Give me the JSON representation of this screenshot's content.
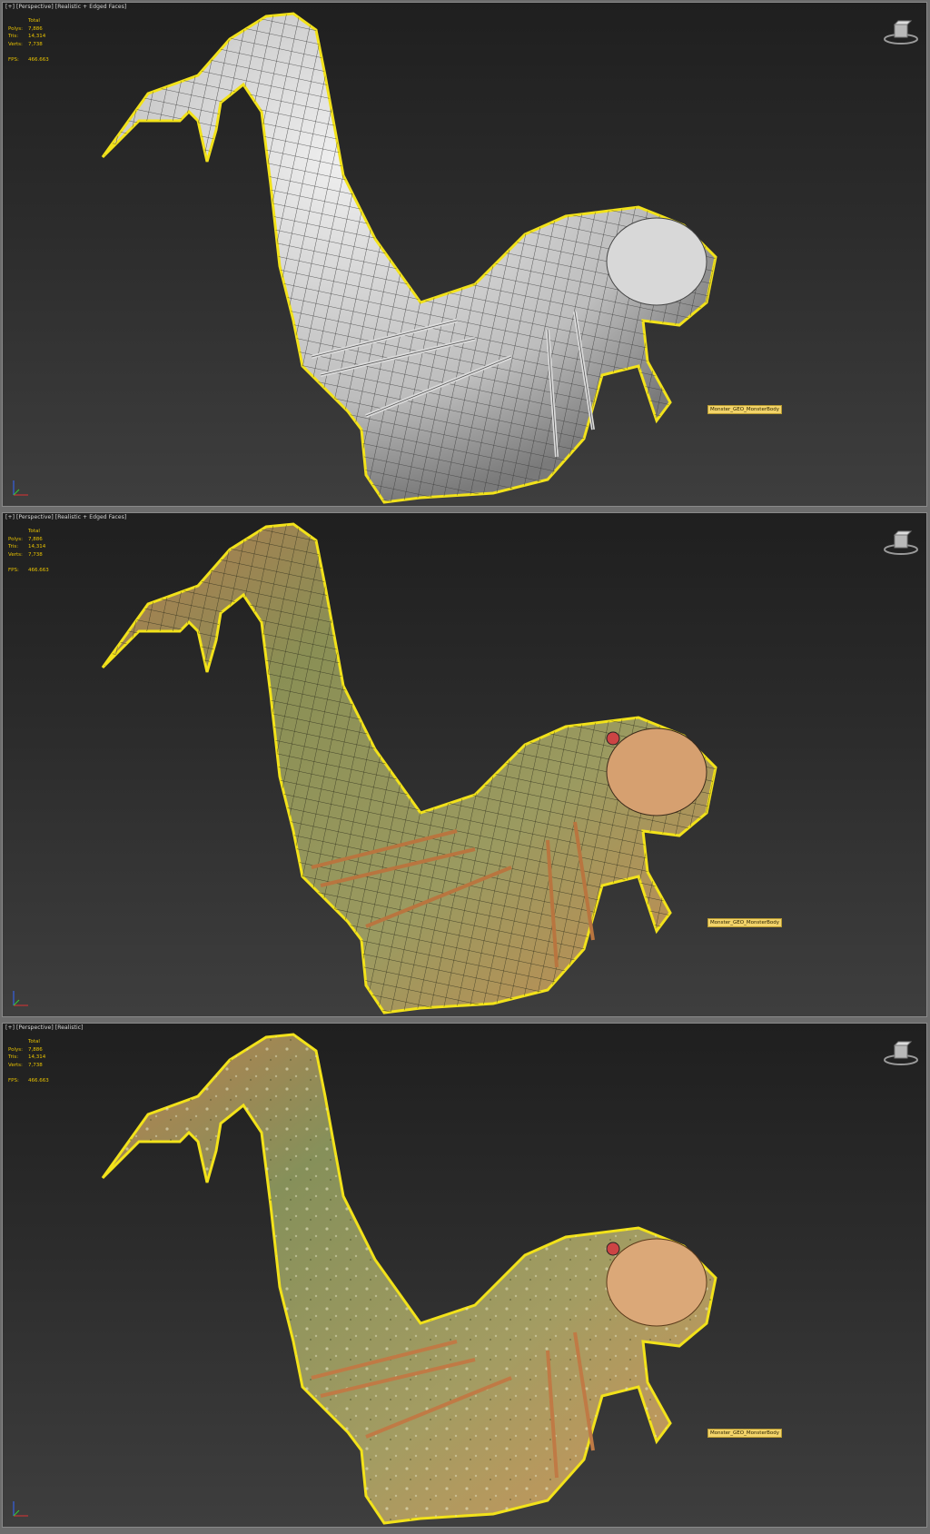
{
  "viewports": [
    {
      "label_parts": [
        "[+]",
        "[Perspective]",
        "[Realistic + Edged Faces]"
      ],
      "stats": {
        "total_label": "Total",
        "polys_label": "Polys:",
        "polys": "7,886",
        "tris_label": "Tris:",
        "tris": "14,314",
        "verts_label": "Verts:",
        "verts": "7,738",
        "fps_label": "FPS:",
        "fps": "466.663"
      },
      "object_tag": "Monster_GEO_MonsterBody",
      "shading": "wireframe-clay"
    },
    {
      "label_parts": [
        "[+]",
        "[Perspective]",
        "[Realistic + Edged Faces]"
      ],
      "stats": {
        "total_label": "Total",
        "polys_label": "Polys:",
        "polys": "7,886",
        "tris_label": "Tris:",
        "tris": "14,314",
        "verts_label": "Verts:",
        "verts": "7,738",
        "fps_label": "FPS:",
        "fps": "466.663"
      },
      "object_tag": "Monster_GEO_MonsterBody",
      "shading": "textured-edged"
    },
    {
      "label_parts": [
        "[+]",
        "[Perspective]",
        "[Realistic]"
      ],
      "stats": {
        "total_label": "Total",
        "polys_label": "Polys:",
        "polys": "7,886",
        "tris_label": "Tris:",
        "tris": "14,314",
        "verts_label": "Verts:",
        "verts": "7,738",
        "fps_label": "FPS:",
        "fps": "466.663"
      },
      "object_tag": "Monster_GEO_MonsterBody",
      "shading": "textured"
    }
  ],
  "colors": {
    "selection_outline": "#f2e21a",
    "stats_text": "#e8c200",
    "tag_bg": "#f3d46a",
    "clay": "#cfcfcf",
    "skin_green": "#8a8f55",
    "skin_orange": "#c78a4f"
  },
  "icons": [
    "viewcube-icon",
    "axis-tripod-icon"
  ]
}
